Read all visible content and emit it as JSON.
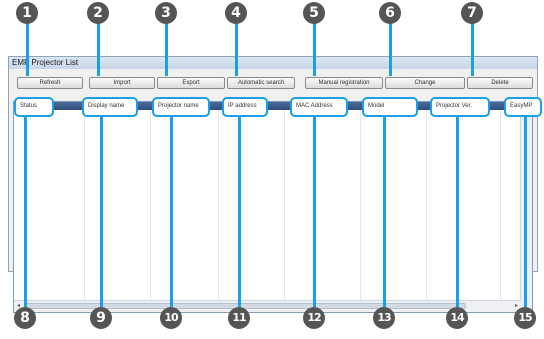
{
  "window": {
    "title": "EMP Projector List"
  },
  "buttons": [
    "Refresh",
    "Import",
    "Export",
    "Automatic search",
    "Manual registration",
    "Change",
    "Delete"
  ],
  "columns": [
    "Status",
    "Display name",
    "Projector name",
    "IP address",
    "MAC Address",
    "Model",
    "Projector Ver.",
    "EasyMP"
  ],
  "callouts": {
    "top": [
      "1",
      "2",
      "3",
      "4",
      "5",
      "6",
      "7"
    ],
    "bottom": [
      "8",
      "9",
      "10",
      "11",
      "12",
      "13",
      "14",
      "15"
    ]
  },
  "scrollbar": {
    "left_arrow": "◂",
    "right_arrow": "▸"
  },
  "colors": {
    "accent": "#1aa0e6",
    "badge": "#555555",
    "header": "#2f4d7c"
  }
}
